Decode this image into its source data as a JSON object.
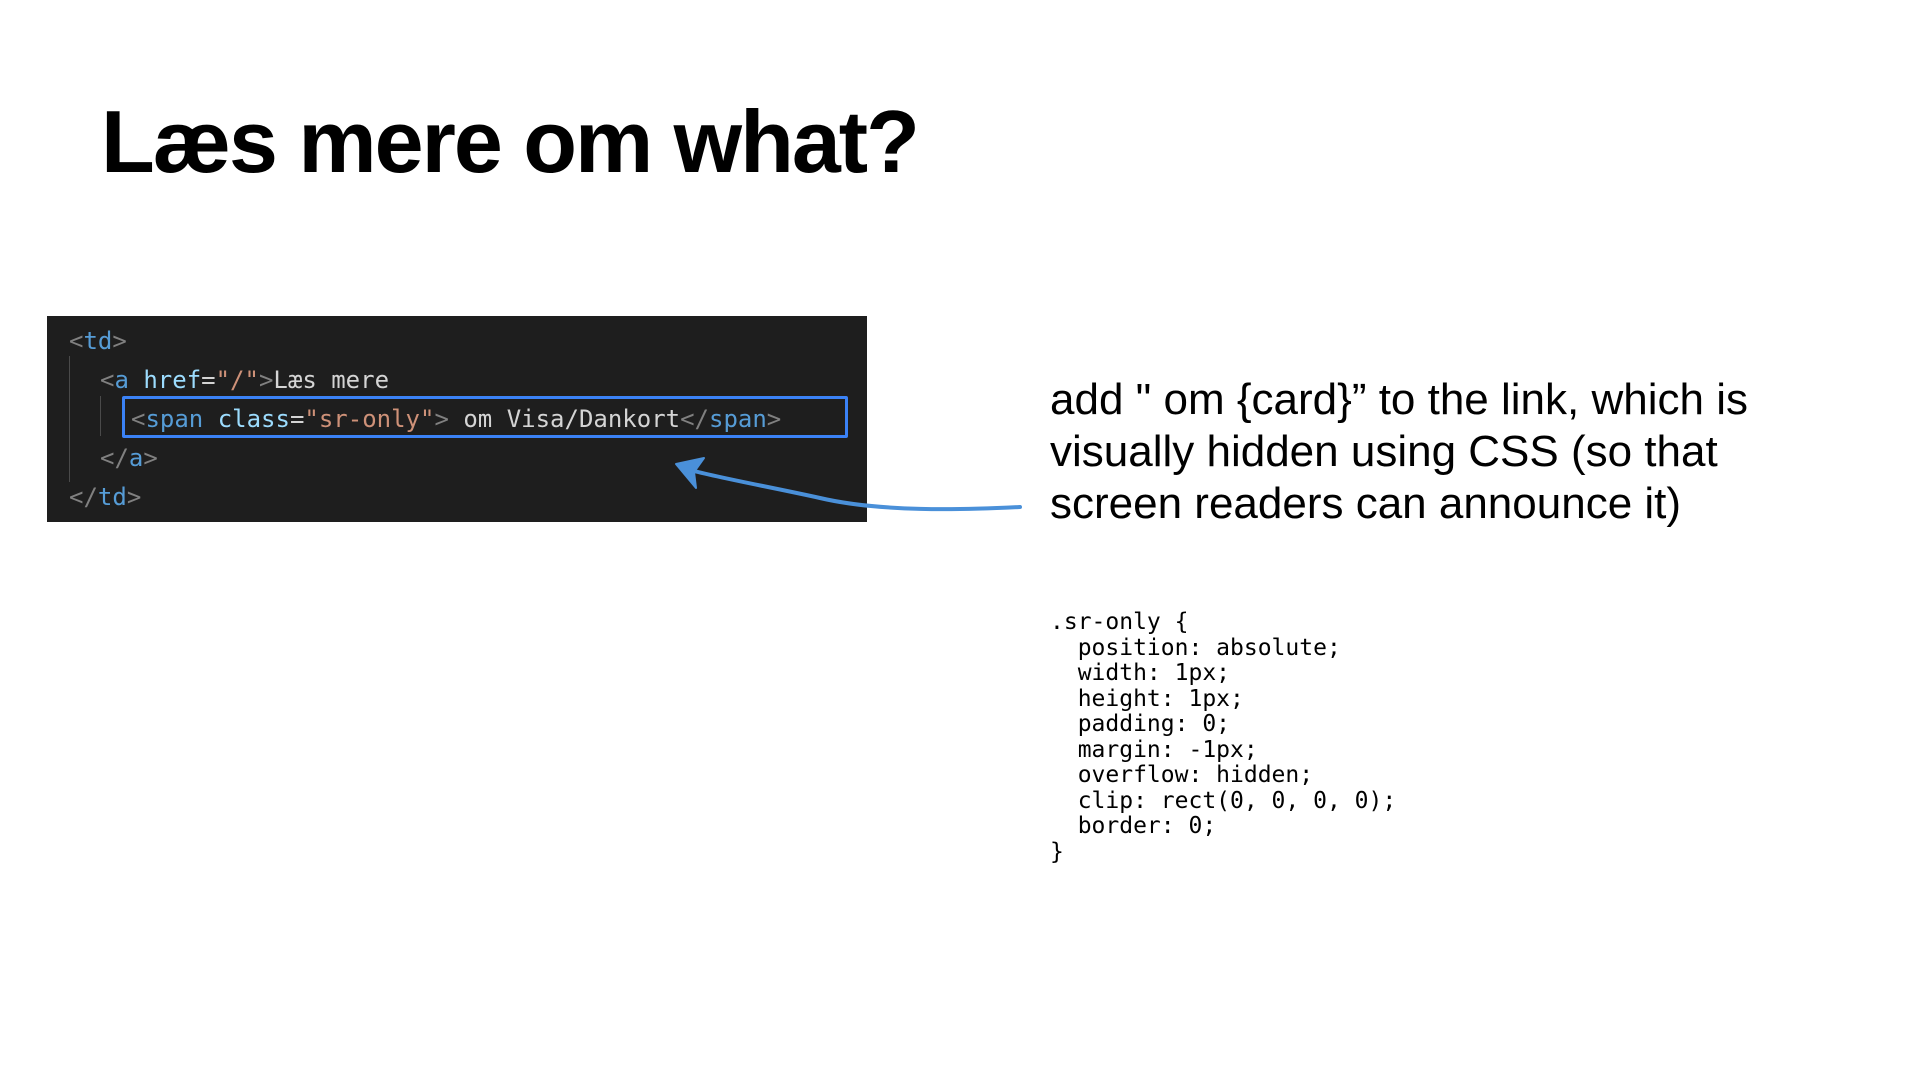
{
  "title": "Læs mere om what?",
  "code_lines": [
    {
      "id": "line1",
      "tokens": [
        {
          "t": "<",
          "c": "punct"
        },
        {
          "t": "td",
          "c": "tag"
        },
        {
          "t": ">",
          "c": "punct"
        }
      ]
    },
    {
      "id": "line2",
      "tokens": [
        {
          "t": "<",
          "c": "punct"
        },
        {
          "t": "a",
          "c": "tag"
        },
        {
          "t": " ",
          "c": "text"
        },
        {
          "t": "href",
          "c": "attr"
        },
        {
          "t": "=",
          "c": "text"
        },
        {
          "t": "\"/\"",
          "c": "str"
        },
        {
          "t": ">",
          "c": "punct"
        },
        {
          "t": "Læs mere",
          "c": "text"
        }
      ]
    },
    {
      "id": "line3",
      "tokens": [
        {
          "t": "<",
          "c": "punct"
        },
        {
          "t": "span",
          "c": "tag"
        },
        {
          "t": " ",
          "c": "text"
        },
        {
          "t": "class",
          "c": "attr"
        },
        {
          "t": "=",
          "c": "text"
        },
        {
          "t": "\"sr-only\"",
          "c": "str"
        },
        {
          "t": ">",
          "c": "punct"
        },
        {
          "t": " om Visa/Dankort",
          "c": "text"
        },
        {
          "t": "</",
          "c": "punct"
        },
        {
          "t": "span",
          "c": "tag"
        },
        {
          "t": ">",
          "c": "punct"
        }
      ]
    },
    {
      "id": "line4",
      "tokens": [
        {
          "t": "</",
          "c": "punct"
        },
        {
          "t": "a",
          "c": "tag"
        },
        {
          "t": ">",
          "c": "punct"
        }
      ]
    },
    {
      "id": "line5",
      "tokens": [
        {
          "t": "</",
          "c": "punct"
        },
        {
          "t": "td",
          "c": "tag"
        },
        {
          "t": ">",
          "c": "punct"
        }
      ]
    }
  ],
  "explanation": "add \" om {card}” to the link, which is visually hidden using CSS (so that screen readers can announce it)",
  "css_snippet": ".sr-only {\n  position: absolute;\n  width: 1px;\n  height: 1px;\n  padding: 0;\n  margin: -1px;\n  overflow: hidden;\n  clip: rect(0, 0, 0, 0);\n  border: 0;\n}",
  "colors": {
    "code_background": "#1e1e1e",
    "highlight": "#3b82f6",
    "arrow": "#4a90d9"
  }
}
